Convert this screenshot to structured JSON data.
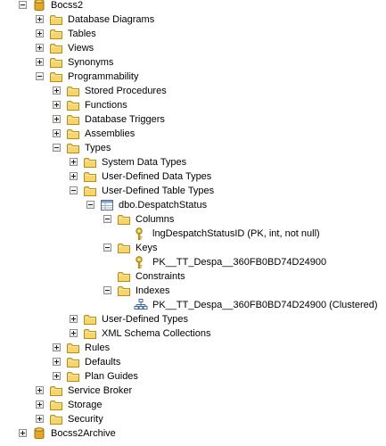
{
  "tree": {
    "items": [
      {
        "label": "Bocss2",
        "icon": "database-icon",
        "toggle": "minus"
      },
      {
        "label": "Database Diagrams",
        "icon": "folder-icon",
        "toggle": "plus"
      },
      {
        "label": "Tables",
        "icon": "folder-icon",
        "toggle": "plus"
      },
      {
        "label": "Views",
        "icon": "folder-icon",
        "toggle": "plus"
      },
      {
        "label": "Synonyms",
        "icon": "folder-icon",
        "toggle": "plus"
      },
      {
        "label": "Programmability",
        "icon": "folder-icon",
        "toggle": "minus"
      },
      {
        "label": "Stored Procedures",
        "icon": "folder-icon",
        "toggle": "plus"
      },
      {
        "label": "Functions",
        "icon": "folder-icon",
        "toggle": "plus"
      },
      {
        "label": "Database Triggers",
        "icon": "folder-icon",
        "toggle": "plus"
      },
      {
        "label": "Assemblies",
        "icon": "folder-icon",
        "toggle": "plus"
      },
      {
        "label": "Types",
        "icon": "folder-icon",
        "toggle": "minus"
      },
      {
        "label": "System Data Types",
        "icon": "folder-icon",
        "toggle": "plus"
      },
      {
        "label": "User-Defined Data Types",
        "icon": "folder-icon",
        "toggle": "plus"
      },
      {
        "label": "User-Defined Table Types",
        "icon": "folder-icon",
        "toggle": "minus"
      },
      {
        "label": "dbo.DespatchStatus",
        "icon": "table-type-icon",
        "toggle": "minus"
      },
      {
        "label": "Columns",
        "icon": "folder-icon",
        "toggle": "minus"
      },
      {
        "label": "lngDespatchStatusID (PK, int, not null)",
        "icon": "key-icon",
        "toggle": "none"
      },
      {
        "label": "Keys",
        "icon": "folder-icon",
        "toggle": "minus"
      },
      {
        "label": "PK__TT_Despa__360FB0BD74D24900",
        "icon": "key-icon",
        "toggle": "none"
      },
      {
        "label": "Constraints",
        "icon": "folder-icon",
        "toggle": "none"
      },
      {
        "label": "Indexes",
        "icon": "folder-icon",
        "toggle": "minus"
      },
      {
        "label": "PK__TT_Despa__360FB0BD74D24900 (Clustered)",
        "icon": "index-icon",
        "toggle": "none"
      },
      {
        "label": "User-Defined Types",
        "icon": "folder-icon",
        "toggle": "plus"
      },
      {
        "label": "XML Schema Collections",
        "icon": "folder-icon",
        "toggle": "plus"
      },
      {
        "label": "Rules",
        "icon": "folder-icon",
        "toggle": "plus"
      },
      {
        "label": "Defaults",
        "icon": "folder-icon",
        "toggle": "plus"
      },
      {
        "label": "Plan Guides",
        "icon": "folder-icon",
        "toggle": "plus"
      },
      {
        "label": "Service Broker",
        "icon": "folder-icon",
        "toggle": "plus"
      },
      {
        "label": "Storage",
        "icon": "folder-icon",
        "toggle": "plus"
      },
      {
        "label": "Security",
        "icon": "folder-icon",
        "toggle": "plus"
      },
      {
        "label": "Bocss2Archive",
        "icon": "database-icon",
        "toggle": "plus"
      }
    ]
  },
  "colors": {
    "folder_fill": "#f6d66a",
    "folder_tab": "#f0c64a",
    "folder_outline": "#b58d1e",
    "database_fill": "#e2a820",
    "key": "#d9a61e",
    "index": "#3a6aa8"
  }
}
